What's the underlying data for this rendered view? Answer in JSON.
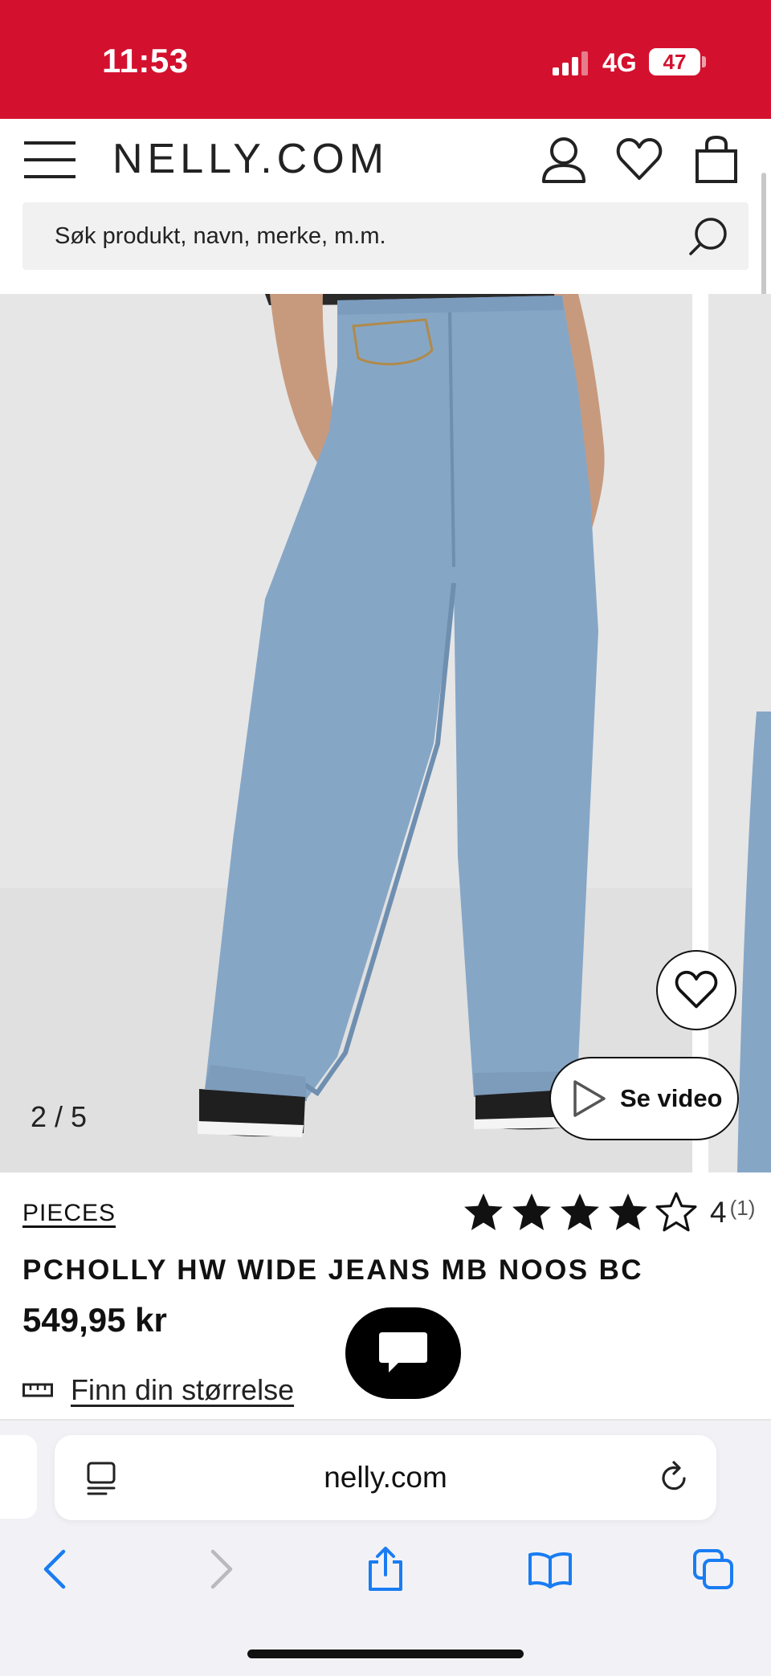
{
  "status_bar": {
    "time": "11:53",
    "network": "4G",
    "battery": "47"
  },
  "header": {
    "logo": "NELLY.COM"
  },
  "search": {
    "placeholder": "Søk produkt, navn, merke, m.m."
  },
  "gallery": {
    "counter": "2 / 5",
    "video_label": "Se video"
  },
  "product": {
    "brand": "PIECES",
    "rating": 4,
    "rating_max": 5,
    "rating_value": "4",
    "rating_count": "(1)",
    "name": "PCHOLLY HW WIDE JEANS MB NOOS BC",
    "price": "549,95 kr",
    "size_link": "Finn din størrelse"
  },
  "browser": {
    "url": "nelly.com"
  },
  "colors": {
    "brand_red": "#d3112e",
    "safari_blue": "#1a7cf2",
    "denim": "#86a6c6"
  },
  "icons": [
    "menu-icon",
    "account-icon",
    "heart-icon",
    "bag-icon",
    "search-icon",
    "play-icon",
    "star-icon",
    "chat-icon",
    "ruler-icon",
    "reader-icon",
    "reload-icon",
    "back-icon",
    "forward-icon",
    "share-icon",
    "bookmarks-icon",
    "tabs-icon"
  ]
}
